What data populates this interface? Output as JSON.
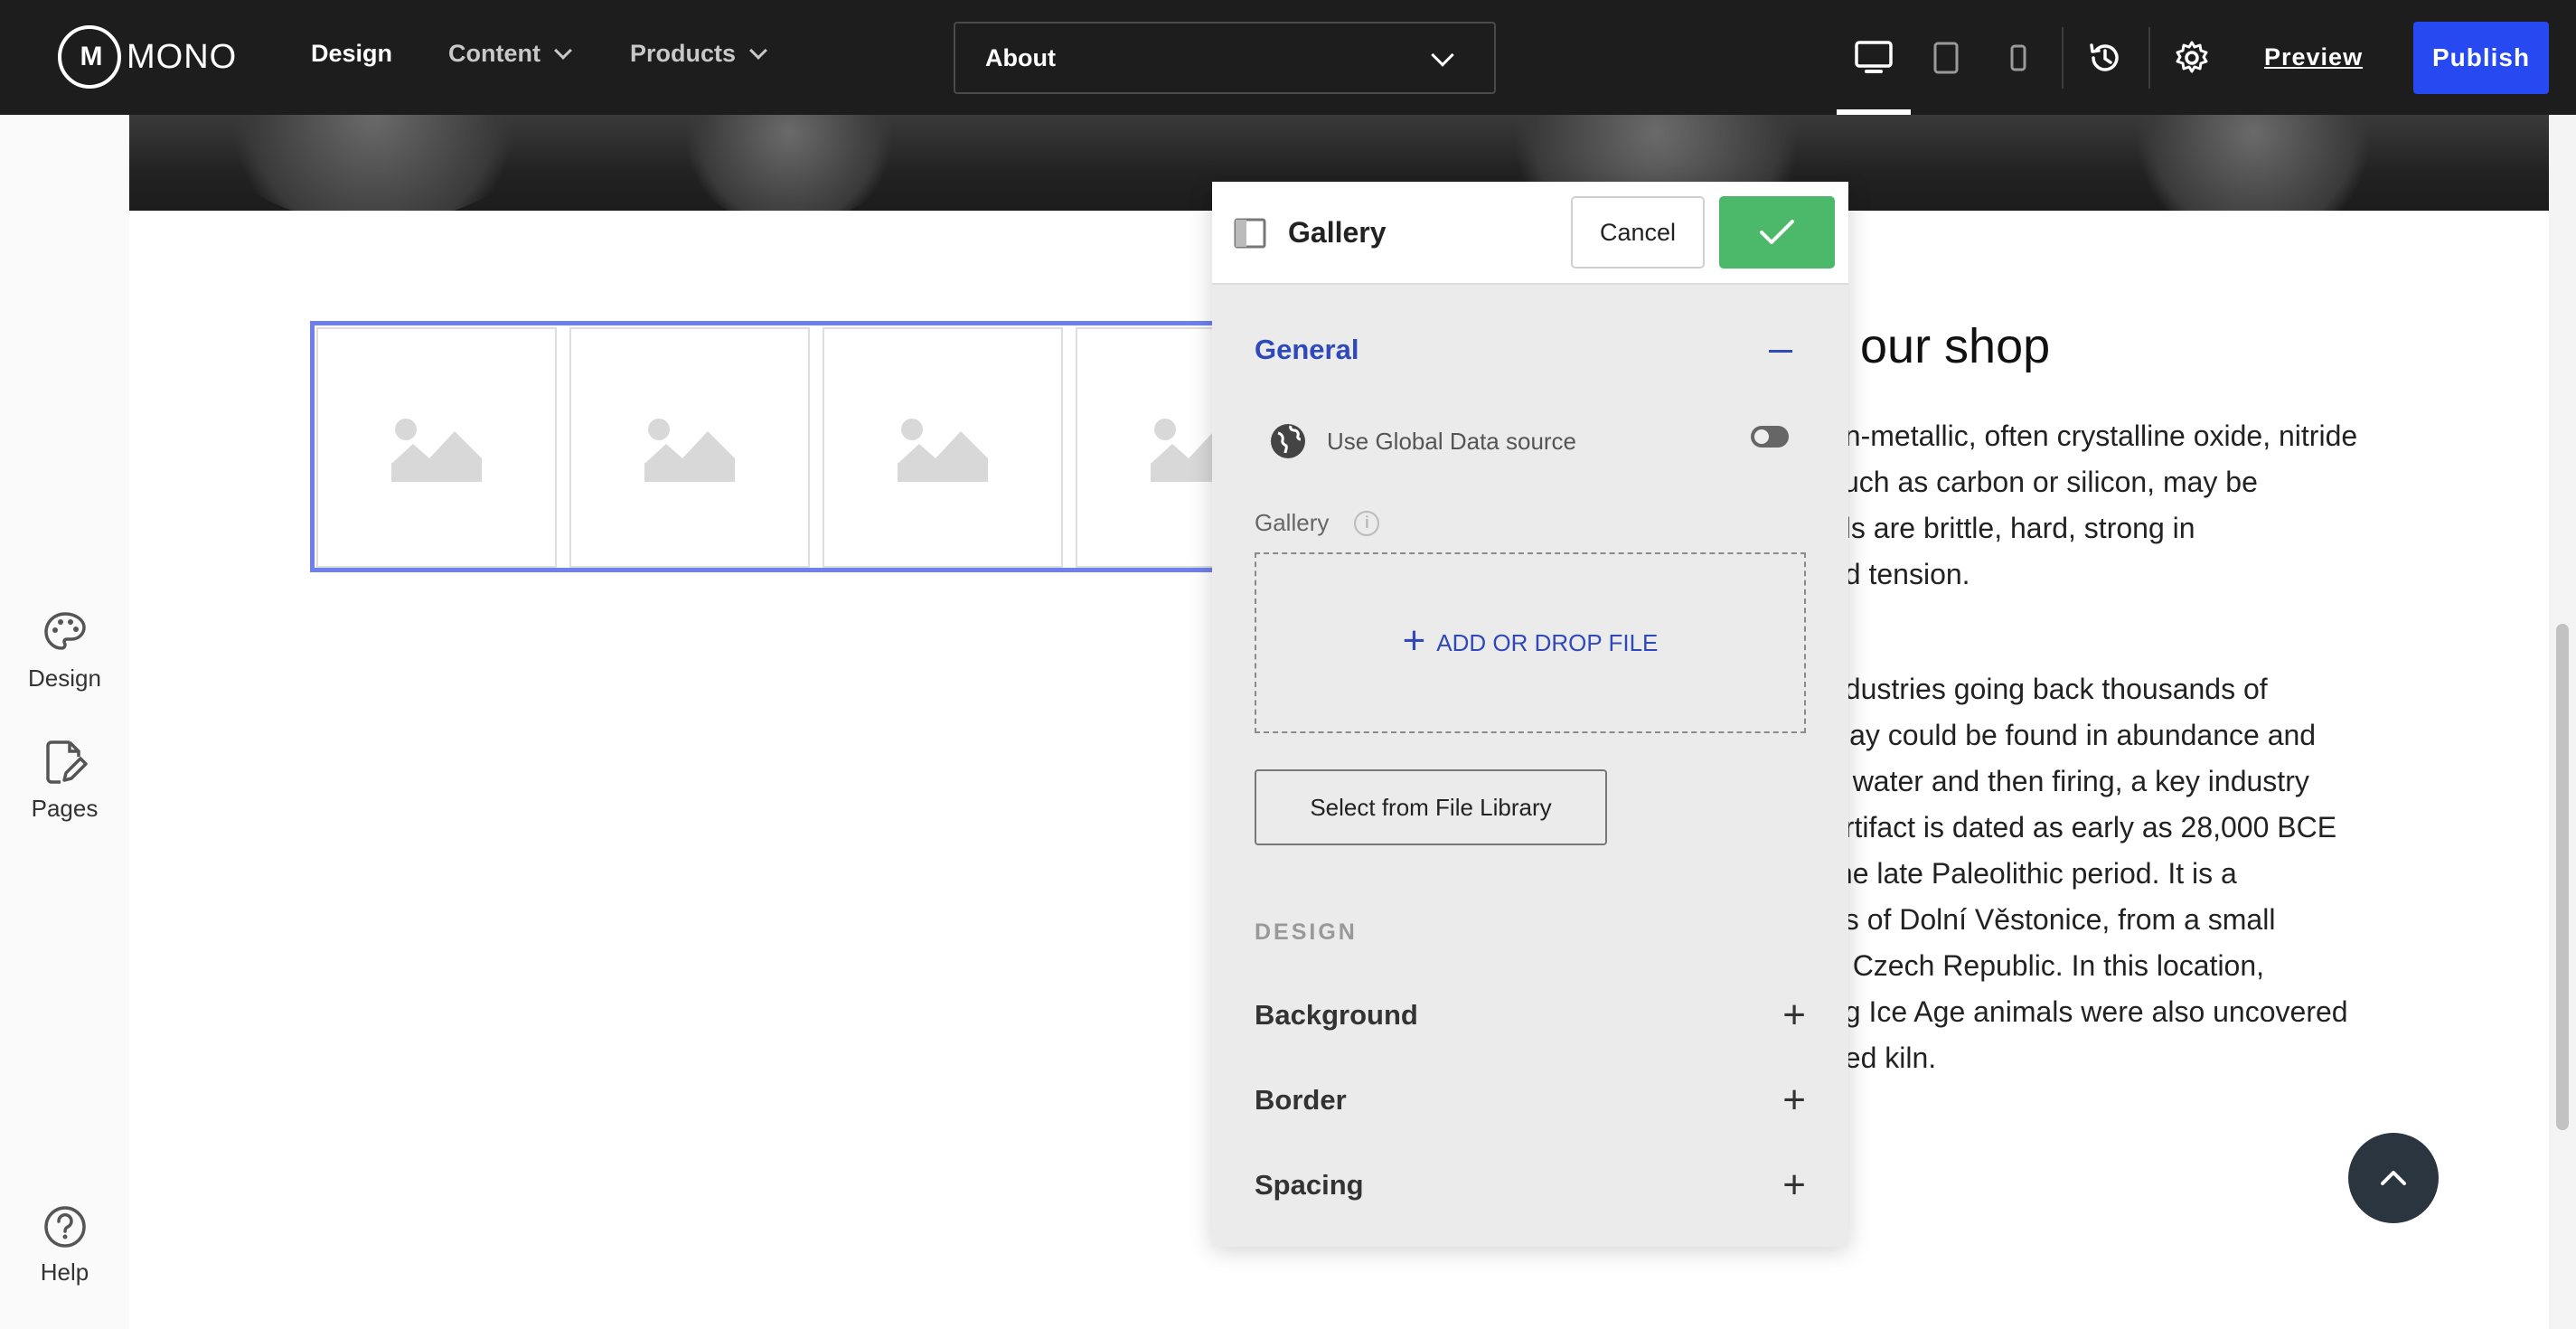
{
  "app": {
    "logo_text": "MONO",
    "logo_mark": "M"
  },
  "nav": {
    "design": "Design",
    "content": "Content",
    "products": "Products"
  },
  "page_select": {
    "value": "About"
  },
  "toolbar": {
    "preview": "Preview",
    "publish": "Publish",
    "icons": [
      "desktop-icon",
      "tablet-icon",
      "mobile-icon",
      "history-icon",
      "gear-icon"
    ]
  },
  "sidebar": {
    "design": "Design",
    "pages": "Pages",
    "help": "Help"
  },
  "canvas": {
    "shop_title": "our shop",
    "para1": [
      "on-metallic, often crystalline oxide, nitride",
      "such as carbon or silicon, may be",
      "als are brittle, hard, strong in",
      "nd tension."
    ],
    "para2": [
      "ndustries going back thousands of",
      "clay could be found in abundance and",
      "h water and then firing, a key industry",
      "artifact is dated as early as 28,000 BCE",
      "the late Paleolithic period. It is a",
      "us of Dolní Věstonice, from a small",
      "e Czech Republic. In this location,",
      "ng Ice Age animals were also uncovered",
      "ped kiln."
    ]
  },
  "panel": {
    "title": "Gallery",
    "cancel": "Cancel",
    "general": "General",
    "global_source": "Use Global Data source",
    "gallery_label": "Gallery",
    "add_file": "ADD OR DROP FILE",
    "file_library": "Select from File Library",
    "design_heading": "DESIGN",
    "background": "Background",
    "border": "Border",
    "spacing": "Spacing"
  },
  "colors": {
    "accent": "#2649f2",
    "confirm": "#4cb86a",
    "section_blue": "#2f49b8",
    "topbar": "#1d1d1d"
  }
}
